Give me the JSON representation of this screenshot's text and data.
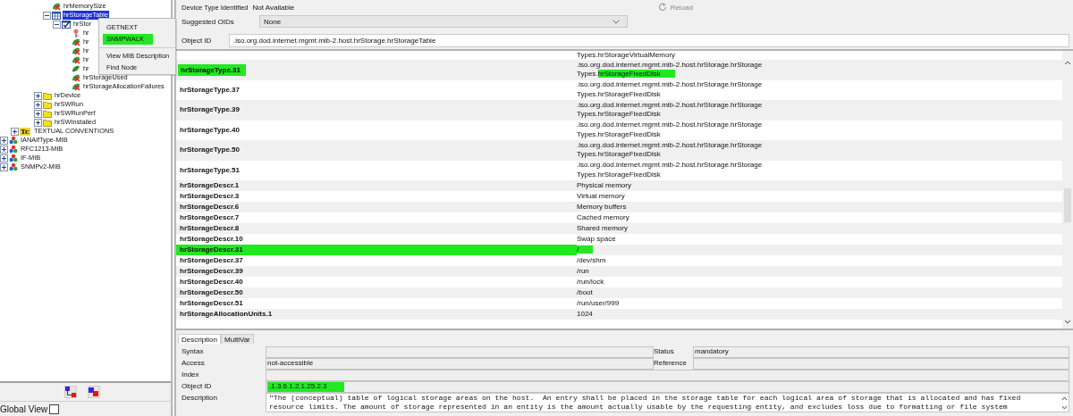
{
  "tree": {
    "items": [
      {
        "label": "hrMemorySize",
        "kind": "leaf-x",
        "selected": false
      },
      {
        "label": "hrStorageTable",
        "kind": "table",
        "selected": true,
        "expanded": true,
        "children": [
          {
            "label": "hrStor",
            "kind": "entry",
            "selected": false,
            "expanded": true,
            "children": [
              {
                "label": "hr",
                "kind": "key",
                "selected": false
              },
              {
                "label": "hr",
                "kind": "leaf-x",
                "selected": false
              },
              {
                "label": "hr",
                "kind": "leaf-x",
                "selected": false
              },
              {
                "label": "hr",
                "kind": "leaf-x",
                "selected": false
              },
              {
                "label": "hr",
                "kind": "leaf",
                "selected": false
              },
              {
                "label": "hrStorageUsed",
                "kind": "leaf-x",
                "selected": false
              },
              {
                "label": "hrStorageAllocationFailures",
                "kind": "leaf-x",
                "selected": false
              }
            ]
          }
        ]
      },
      {
        "label": "hrDevice",
        "kind": "folder",
        "selected": false,
        "expanded": false
      },
      {
        "label": "hrSWRun",
        "kind": "folder",
        "selected": false,
        "expanded": false
      },
      {
        "label": "hrSWRunPerf",
        "kind": "folder",
        "selected": false,
        "expanded": false
      },
      {
        "label": "hrSWInstalled",
        "kind": "folder",
        "selected": false,
        "expanded": false
      },
      {
        "label": "TEXTUAL CONVENTIONS",
        "kind": "tc",
        "badge": "Tc",
        "selected": false,
        "expanded": false
      },
      {
        "label": "IANAifType-MIB",
        "kind": "mib",
        "selected": false,
        "expanded": false
      },
      {
        "label": "RFC1213-MIB",
        "kind": "mib",
        "selected": false,
        "expanded": false
      },
      {
        "label": "IF-MIB",
        "kind": "mib",
        "selected": false,
        "expanded": false
      },
      {
        "label": "SNMPv2-MIB",
        "kind": "mib",
        "selected": false,
        "expanded": false
      }
    ]
  },
  "context_menu": {
    "items": [
      {
        "kind": "item",
        "label": "GETNEXT",
        "highlighted": false
      },
      {
        "kind": "item",
        "label": "SNMPWALK",
        "highlighted": true
      },
      {
        "kind": "separator"
      },
      {
        "kind": "item",
        "label": "View MIB Description",
        "highlighted": false
      },
      {
        "kind": "item",
        "label": "Find Node",
        "highlighted": false
      }
    ]
  },
  "left_toolbar": {
    "buttons": [
      {
        "kind": "linked"
      },
      {
        "kind": "overlap"
      }
    ]
  },
  "global_view": {
    "label": "Global View",
    "checked": false
  },
  "device": {
    "label": "Device Type Identified",
    "value": "Not Available",
    "reload": {
      "label": "Reload",
      "disabled": true
    }
  },
  "suggested_oids": {
    "label": "Suggested OIDs",
    "value": "None"
  },
  "object_id": {
    "label": "Object ID",
    "value": ".iso.org.dod.internet.mgmt.mib-2.host.hrStorage.hrStorageTable"
  },
  "table": {
    "rows": [
      {
        "value_lines": [
          [
            {
              "text": "Types.hrStorageVirtualMemory",
              "highlighted": false
            }
          ]
        ]
      },
      {
        "name": "hrStorageType.31",
        "name_highlighted": true,
        "row_highlighted": false,
        "value_lines": [
          [
            {
              "text": ".iso.org.dod.internet.mgmt.mib-2.host.hrStorage.hrStorage",
              "highlighted": false
            }
          ],
          [
            {
              "text": "Types.",
              "highlighted": false
            },
            {
              "text": "hrStorageFixedDisk",
              "highlighted": true
            }
          ]
        ]
      },
      {
        "name": "hrStorageType.37",
        "name_highlighted": false,
        "row_highlighted": false,
        "value_lines": [
          [
            {
              "text": ".iso.org.dod.internet.mgmt.mib-2.host.hrStorage.hrStorage",
              "highlighted": false
            }
          ],
          [
            {
              "text": "Types.hrStorageFixedDisk",
              "highlighted": false
            }
          ]
        ]
      },
      {
        "name": "hrStorageType.39",
        "name_highlighted": false,
        "row_highlighted": false,
        "value_lines": [
          [
            {
              "text": ".iso.org.dod.internet.mgmt.mib-2.host.hrStorage.hrStorage",
              "highlighted": false
            }
          ],
          [
            {
              "text": "Types.hrStorageFixedDisk",
              "highlighted": false
            }
          ]
        ]
      },
      {
        "name": "hrStorageType.40",
        "name_highlighted": false,
        "row_highlighted": false,
        "value_lines": [
          [
            {
              "text": ".iso.org.dod.internet.mgmt.mib-2.host.hrStorage.hrStorage",
              "highlighted": false
            }
          ],
          [
            {
              "text": "Types.hrStorageFixedDisk",
              "highlighted": false
            }
          ]
        ]
      },
      {
        "name": "hrStorageType.50",
        "name_highlighted": false,
        "row_highlighted": false,
        "value_lines": [
          [
            {
              "text": ".iso.org.dod.internet.mgmt.mib-2.host.hrStorage.hrStorage",
              "highlighted": false
            }
          ],
          [
            {
              "text": "Types.hrStorageFixedDisk",
              "highlighted": false
            }
          ]
        ]
      },
      {
        "name": "hrStorageType.51",
        "name_highlighted": false,
        "row_highlighted": false,
        "value_lines": [
          [
            {
              "text": ".iso.org.dod.internet.mgmt.mib-2.host.hrStorage.hrStorage",
              "highlighted": false
            }
          ],
          [
            {
              "text": "Types.hrStorageFixedDisk",
              "highlighted": false
            }
          ]
        ]
      },
      {
        "name": "hrStorageDescr.1",
        "name_highlighted": false,
        "row_highlighted": false,
        "value_lines": [
          [
            {
              "text": "Physical memory",
              "highlighted": false
            }
          ]
        ]
      },
      {
        "name": "hrStorageDescr.3",
        "name_highlighted": false,
        "row_highlighted": false,
        "value_lines": [
          [
            {
              "text": "Virtual memory",
              "highlighted": false
            }
          ]
        ]
      },
      {
        "name": "hrStorageDescr.6",
        "name_highlighted": false,
        "row_highlighted": false,
        "value_lines": [
          [
            {
              "text": "Memory buffers",
              "highlighted": false
            }
          ]
        ]
      },
      {
        "name": "hrStorageDescr.7",
        "name_highlighted": false,
        "row_highlighted": false,
        "value_lines": [
          [
            {
              "text": "Cached memory",
              "highlighted": false
            }
          ]
        ]
      },
      {
        "name": "hrStorageDescr.8",
        "name_highlighted": false,
        "row_highlighted": false,
        "value_lines": [
          [
            {
              "text": "Shared memory",
              "highlighted": false
            }
          ]
        ]
      },
      {
        "name": "hrStorageDescr.10",
        "name_highlighted": false,
        "row_highlighted": false,
        "value_lines": [
          [
            {
              "text": "Swap space",
              "highlighted": false
            }
          ]
        ]
      },
      {
        "name": "hrStorageDescr.31",
        "name_highlighted": false,
        "row_highlighted": true,
        "value_lines": [
          [
            {
              "text": "/",
              "highlighted": true
            }
          ]
        ]
      },
      {
        "name": "hrStorageDescr.37",
        "name_highlighted": false,
        "row_highlighted": false,
        "value_lines": [
          [
            {
              "text": "/dev/shm",
              "highlighted": false
            }
          ]
        ]
      },
      {
        "name": "hrStorageDescr.39",
        "name_highlighted": false,
        "row_highlighted": false,
        "value_lines": [
          [
            {
              "text": "/run",
              "highlighted": false
            }
          ]
        ]
      },
      {
        "name": "hrStorageDescr.40",
        "name_highlighted": false,
        "row_highlighted": false,
        "value_lines": [
          [
            {
              "text": "/run/lock",
              "highlighted": false
            }
          ]
        ]
      },
      {
        "name": "hrStorageDescr.50",
        "name_highlighted": false,
        "row_highlighted": false,
        "value_lines": [
          [
            {
              "text": "/boot",
              "highlighted": false
            }
          ]
        ]
      },
      {
        "name": "hrStorageDescr.51",
        "name_highlighted": false,
        "row_highlighted": false,
        "value_lines": [
          [
            {
              "text": "/run/user/999",
              "highlighted": false
            }
          ]
        ]
      },
      {
        "name": "hrStorageAllocationUnits.1",
        "name_highlighted": false,
        "row_highlighted": false,
        "value_lines": [
          [
            {
              "text": "1024",
              "highlighted": false
            }
          ]
        ]
      }
    ]
  },
  "detail_tabs": [
    {
      "label": "Description",
      "selected": true
    },
    {
      "label": "MultiVar",
      "selected": false
    }
  ],
  "details": {
    "syntax": {
      "label": "Syntax"
    },
    "status": {
      "label": "Status",
      "value": "mandatory"
    },
    "access": {
      "label": "Access",
      "value": "not-accessible"
    },
    "reference": {
      "label": "Reference"
    },
    "index": {
      "label": "Index"
    },
    "object_id": {
      "label": "Object ID",
      "value": ".1.3.6.1.2.1.25.2.3",
      "highlighted": true
    },
    "description": {
      "label": "Description",
      "lines": [
        "\"The (conceptual) table of logical storage areas on the host.  An entry shall be placed in the storage table for each logical area of storage that is allocated and has fixed",
        "resource limits. The amount of storage represented in an entity is the amount actually usable by the requesting entity, and excludes loss due to formatting or file system"
      ]
    }
  }
}
